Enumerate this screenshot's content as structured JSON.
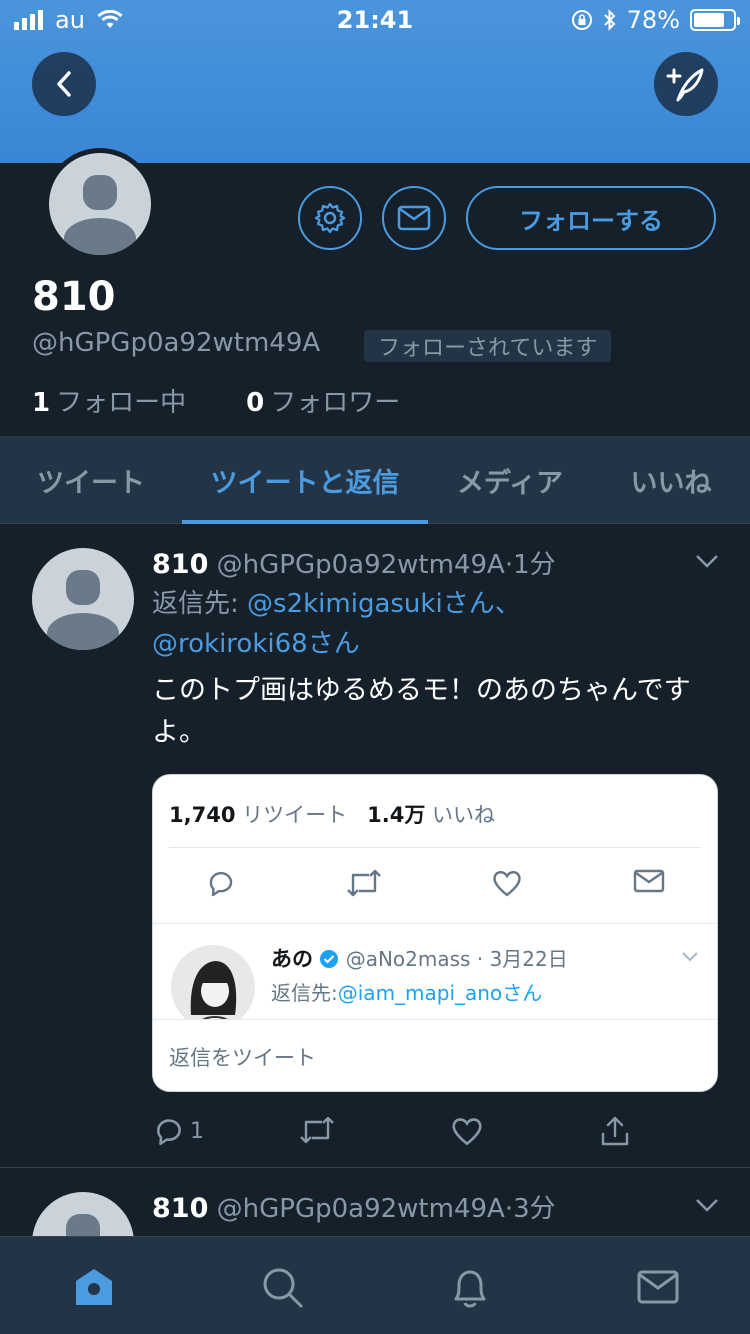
{
  "status_bar": {
    "carrier": "au",
    "time": "21:41",
    "battery": "78%",
    "battery_level": 0.78
  },
  "colors": {
    "accent": "#4a9be0",
    "background": "#15202b",
    "panel": "#243447",
    "header": "#3a86d6"
  },
  "profile": {
    "name": "810",
    "handle": "@hGPGp0a92wtm49A",
    "follows_you": "フォローされています",
    "follow_button": "フォローする",
    "following_count": "1",
    "following_label": "フォロー中",
    "followers_count": "0",
    "followers_label": "フォロワー"
  },
  "tabs": [
    {
      "label": "ツイート",
      "active": false
    },
    {
      "label": "ツイートと返信",
      "active": true
    },
    {
      "label": "メディア",
      "active": false
    },
    {
      "label": "いいね",
      "active": false
    }
  ],
  "tweets": [
    {
      "name": "810",
      "handle": "@hGPGp0a92wtm49A",
      "time": "1分",
      "reply_prefix": "返信先:",
      "reply_to_1": "@s2kimigasukiさん、",
      "reply_to_2": "@rokiroki68さん",
      "text": "このトプ画はゆるめるモ！のあのちゃんですよ。",
      "reply_count": "1",
      "card": {
        "retweets_count": "1,740",
        "retweets_label": "リツイート",
        "likes_count": "1.4万",
        "likes_label": "いいね",
        "quote_name": "あの",
        "quote_handle": "@aNo2mass",
        "quote_date": "3月22日",
        "quote_reply_prefix": "返信先:",
        "quote_reply_to": "@iam_mapi_anoさん",
        "reply_placeholder": "返信をツイート"
      }
    },
    {
      "name": "810",
      "handle": "@hGPGp0a92wtm49A",
      "time": "3分"
    }
  ],
  "icons": {
    "back": "back-arrow-icon",
    "compose": "compose-icon",
    "settings": "gear-icon",
    "message": "envelope-icon",
    "nav": [
      "home-icon",
      "search-icon",
      "notifications-icon",
      "messages-icon"
    ]
  }
}
